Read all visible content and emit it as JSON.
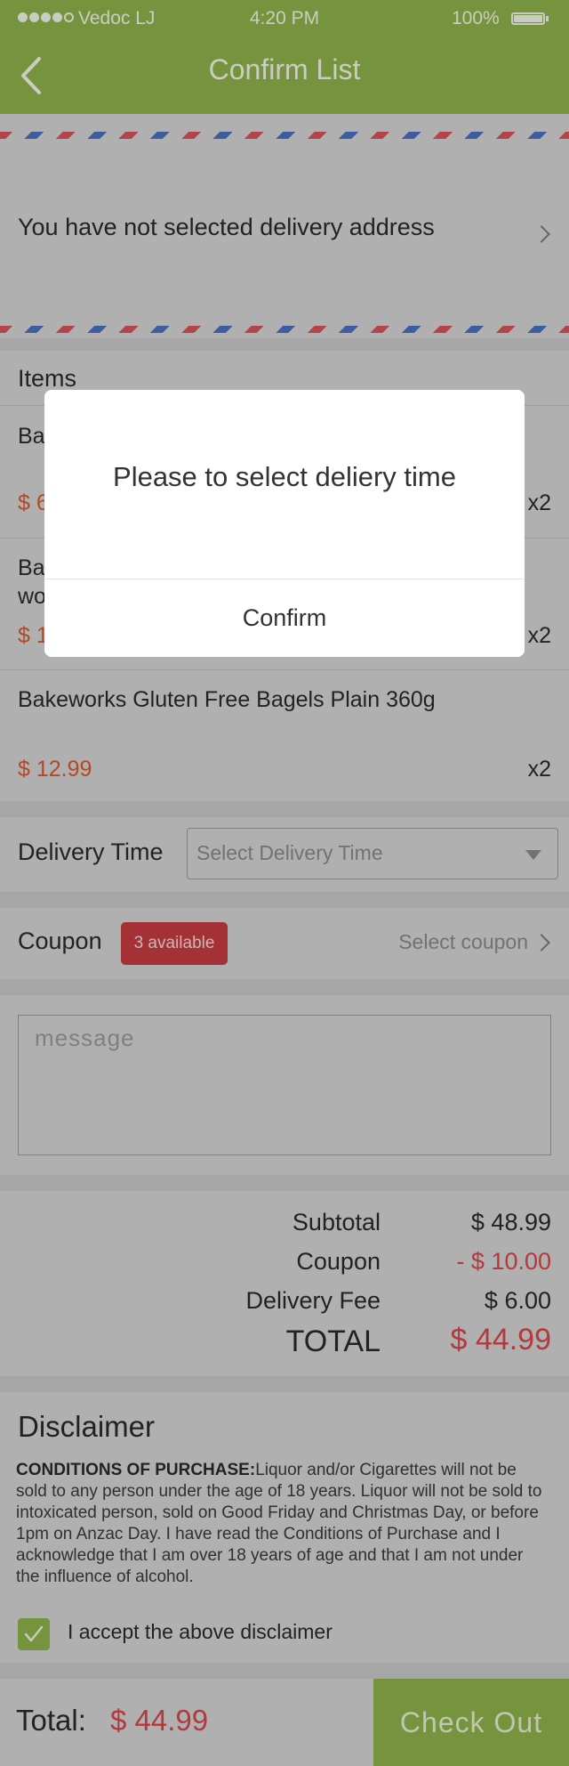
{
  "status_bar": {
    "carrier": "Vedoc LJ",
    "time": "4:20 PM",
    "battery": "100%"
  },
  "header": {
    "title": "Confirm List",
    "back_icon": "chevron-left-icon"
  },
  "address": {
    "text": "You have not selected delivery address"
  },
  "items": {
    "title": "Items",
    "list": [
      {
        "name": "Ba",
        "price": "$ 6",
        "qty": "x2"
      },
      {
        "name": "Ba\nwo",
        "price": "$ 1",
        "qty": "x2"
      },
      {
        "name": "Bakeworks Gluten Free Bagels Plain 360g",
        "price": "$ 12.99",
        "qty": "x2"
      }
    ]
  },
  "delivery": {
    "label": "Delivery Time",
    "placeholder": "Select Delivery Time"
  },
  "coupon": {
    "label": "Coupon",
    "badge": "3 available",
    "link": "Select coupon"
  },
  "message": {
    "placeholder": "message"
  },
  "summary": {
    "subtotal_label": "Subtotal",
    "subtotal": "$ 48.99",
    "coupon_label": "Coupon",
    "coupon": "- $ 10.00",
    "delivery_label": "Delivery Fee",
    "delivery": "$ 6.00",
    "total_label": "TOTAL",
    "total": "$ 44.99"
  },
  "disclaimer": {
    "title": "Disclaimer",
    "heading": "CONDITIONS OF PURCHASE:",
    "body": "Liquor and/or Cigarettes will not be sold to any person under the age of 18 years. Liquor will not be sold to intoxicated person, sold on Good Friday and Christmas Day, or before 1pm on Anzac Day. I have read the Conditions of Purchase and I acknowledge that I am over 18 years of age and that I am not under the influence of alcohol.",
    "accept_label": "I accept the above disclaimer",
    "accepted": true
  },
  "footer": {
    "total_label": "Total:",
    "total": "$ 44.99",
    "checkout_label": "Check Out"
  },
  "dialog": {
    "message": "Please to select deliery time",
    "confirm_label": "Confirm"
  },
  "colors": {
    "brand_green": "#8eb24a",
    "price_orange": "#d9572e",
    "alert_red": "#c43c42",
    "total_red": "#d8454a"
  }
}
